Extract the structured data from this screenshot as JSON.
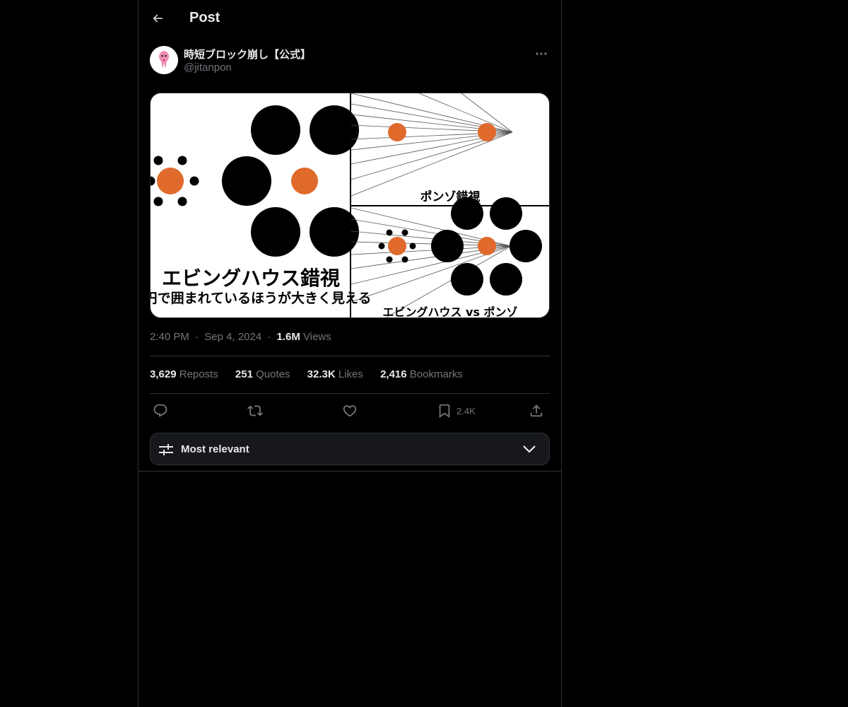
{
  "header": {
    "title": "Post"
  },
  "post": {
    "author": {
      "display_name": "時短ブロック崩し【公式】",
      "handle": "@jitanpon"
    },
    "media": {
      "panel_main_title": "エビングハウス錯視",
      "panel_main_subtitle": "小円で囲まれているほうが大きく見える",
      "panel_top_right_title": "ポンゾ錯視",
      "panel_bottom_right_title": "エビングハウス vs ポンゾ",
      "colors": {
        "dot": "#e06a2c",
        "circle": "#000000",
        "background": "#ffffff"
      }
    },
    "time": "2:40 PM",
    "date": "Sep 4, 2024",
    "separator": "·",
    "views_count": "1.6M",
    "views_label": "Views"
  },
  "stats": {
    "reposts_count": "3,629",
    "reposts_label": "Reposts",
    "quotes_count": "251",
    "quotes_label": "Quotes",
    "likes_count": "32.3K",
    "likes_label": "Likes",
    "bookmarks_count": "2,416",
    "bookmarks_label": "Bookmarks"
  },
  "actions": {
    "reply_icon": "reply-icon",
    "repost_icon": "repost-icon",
    "like_icon": "heart-icon",
    "bookmark_icon": "bookmark-icon",
    "bookmark_count": "2.4K",
    "share_icon": "share-icon"
  },
  "replies_sort": {
    "label": "Most relevant"
  },
  "theme": {
    "background": "#000000",
    "text": "#e7e9ea",
    "muted": "#71767b",
    "border": "#2f3336"
  }
}
